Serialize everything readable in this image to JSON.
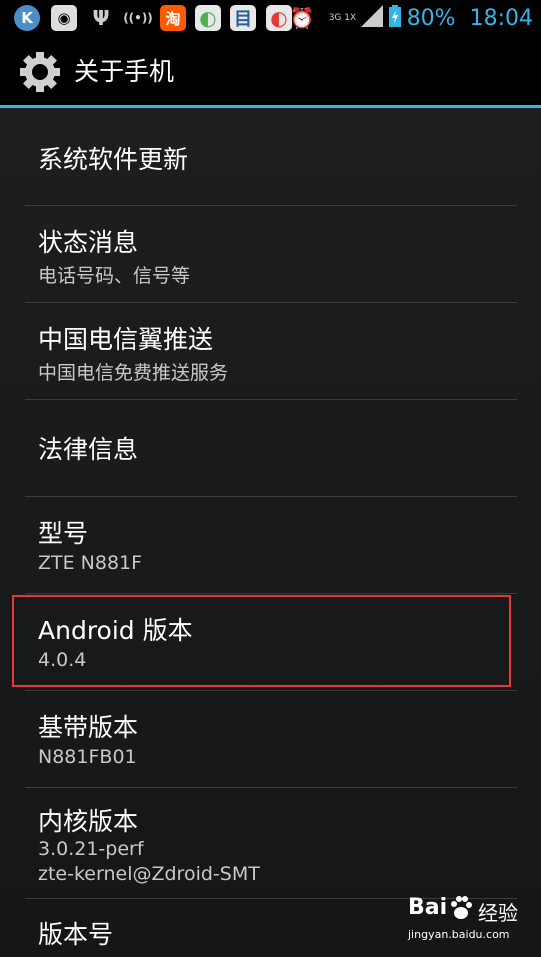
{
  "statusbar": {
    "icons": [
      {
        "name": "k-app-icon",
        "glyph": "K",
        "color": "#4a90c8"
      },
      {
        "name": "disc-icon",
        "glyph": "◉",
        "color": "#555555"
      },
      {
        "name": "usb-icon",
        "glyph": "Ψ",
        "color": "#000000"
      },
      {
        "name": "wifi-hotspot-icon",
        "glyph": "((•))",
        "color": "#000000"
      },
      {
        "name": "taobao-icon",
        "glyph": "淘",
        "color": "#ff5a00"
      },
      {
        "name": "browser-icon",
        "glyph": "◐",
        "color": "#6aa84f"
      },
      {
        "name": "calendar-icon",
        "glyph": "目",
        "color": "#3d6fa8"
      },
      {
        "name": "browser2-icon",
        "glyph": "◐",
        "color": "#6aa84f"
      }
    ],
    "network": "3G 1X",
    "battery": "80%",
    "time": "18:04"
  },
  "titlebar": {
    "title": "关于手机"
  },
  "items": [
    {
      "title": "系统软件更新",
      "sub": ""
    },
    {
      "title": "状态消息",
      "sub": "电话号码、信号等"
    },
    {
      "title": "中国电信翼推送",
      "sub": "中国电信免费推送服务"
    },
    {
      "title": "法律信息",
      "sub": ""
    },
    {
      "title": "型号",
      "sub": "ZTE N881F"
    },
    {
      "title": "Android 版本",
      "sub": "4.0.4"
    },
    {
      "title": "基带版本",
      "sub": "N881FB01"
    },
    {
      "title": "内核版本",
      "sub": "3.0.21-perf",
      "sub2": "zte-kernel@Zdroid-SMT"
    },
    {
      "title": "版本号",
      "sub": ""
    }
  ],
  "watermark": {
    "brand": "Bai",
    "brand2": "经验",
    "url": "jingyan.baidu.com"
  },
  "colors": {
    "accent": "#33b5e5",
    "highlight": "#e53935"
  }
}
